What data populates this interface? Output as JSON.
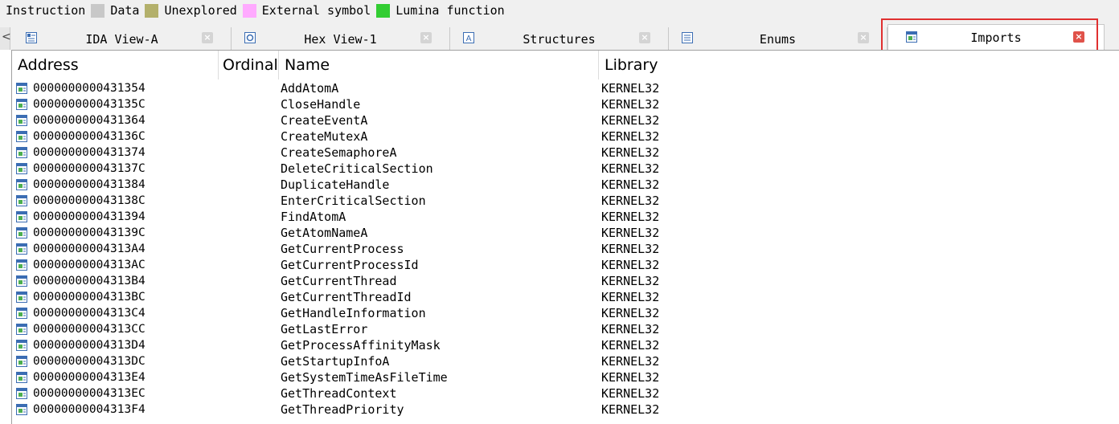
{
  "legend": [
    {
      "label": "Instruction",
      "color": ""
    },
    {
      "label": "Data",
      "color": "#c8c8c8"
    },
    {
      "label": "Unexplored",
      "color": "#b3b06b"
    },
    {
      "label": "External symbol",
      "color": "#ffaaff"
    },
    {
      "label": "Lumina function",
      "color": "#32cd32"
    }
  ],
  "tabs": [
    {
      "label": "IDA View-A",
      "icon": "ida-view-icon",
      "active": false
    },
    {
      "label": "Hex View-1",
      "icon": "hex-view-icon",
      "active": false
    },
    {
      "label": "Structures",
      "icon": "structures-icon",
      "active": false
    },
    {
      "label": "Enums",
      "icon": "enums-icon",
      "active": false
    },
    {
      "label": "Imports",
      "icon": "imports-icon",
      "active": true
    }
  ],
  "table": {
    "columns": [
      "Address",
      "Ordinal",
      "Name",
      "Library"
    ],
    "rows": [
      {
        "address": "0000000000431354",
        "ordinal": "",
        "name": "AddAtomA",
        "library": "KERNEL32"
      },
      {
        "address": "000000000043135C",
        "ordinal": "",
        "name": "CloseHandle",
        "library": "KERNEL32"
      },
      {
        "address": "0000000000431364",
        "ordinal": "",
        "name": "CreateEventA",
        "library": "KERNEL32"
      },
      {
        "address": "000000000043136C",
        "ordinal": "",
        "name": "CreateMutexA",
        "library": "KERNEL32"
      },
      {
        "address": "0000000000431374",
        "ordinal": "",
        "name": "CreateSemaphoreA",
        "library": "KERNEL32"
      },
      {
        "address": "000000000043137C",
        "ordinal": "",
        "name": "DeleteCriticalSection",
        "library": "KERNEL32"
      },
      {
        "address": "0000000000431384",
        "ordinal": "",
        "name": "DuplicateHandle",
        "library": "KERNEL32"
      },
      {
        "address": "000000000043138C",
        "ordinal": "",
        "name": "EnterCriticalSection",
        "library": "KERNEL32"
      },
      {
        "address": "0000000000431394",
        "ordinal": "",
        "name": "FindAtomA",
        "library": "KERNEL32"
      },
      {
        "address": "000000000043139C",
        "ordinal": "",
        "name": "GetAtomNameA",
        "library": "KERNEL32"
      },
      {
        "address": "00000000004313A4",
        "ordinal": "",
        "name": "GetCurrentProcess",
        "library": "KERNEL32"
      },
      {
        "address": "00000000004313AC",
        "ordinal": "",
        "name": "GetCurrentProcessId",
        "library": "KERNEL32"
      },
      {
        "address": "00000000004313B4",
        "ordinal": "",
        "name": "GetCurrentThread",
        "library": "KERNEL32"
      },
      {
        "address": "00000000004313BC",
        "ordinal": "",
        "name": "GetCurrentThreadId",
        "library": "KERNEL32"
      },
      {
        "address": "00000000004313C4",
        "ordinal": "",
        "name": "GetHandleInformation",
        "library": "KERNEL32"
      },
      {
        "address": "00000000004313CC",
        "ordinal": "",
        "name": "GetLastError",
        "library": "KERNEL32"
      },
      {
        "address": "00000000004313D4",
        "ordinal": "",
        "name": "GetProcessAffinityMask",
        "library": "KERNEL32"
      },
      {
        "address": "00000000004313DC",
        "ordinal": "",
        "name": "GetStartupInfoA",
        "library": "KERNEL32"
      },
      {
        "address": "00000000004313E4",
        "ordinal": "",
        "name": "GetSystemTimeAsFileTime",
        "library": "KERNEL32"
      },
      {
        "address": "00000000004313EC",
        "ordinal": "",
        "name": "GetThreadContext",
        "library": "KERNEL32"
      },
      {
        "address": "00000000004313F4",
        "ordinal": "",
        "name": "GetThreadPriority",
        "library": "KERNEL32"
      }
    ]
  },
  "colors": {
    "highlight": "#e03030",
    "close_active": "#e0524a"
  }
}
